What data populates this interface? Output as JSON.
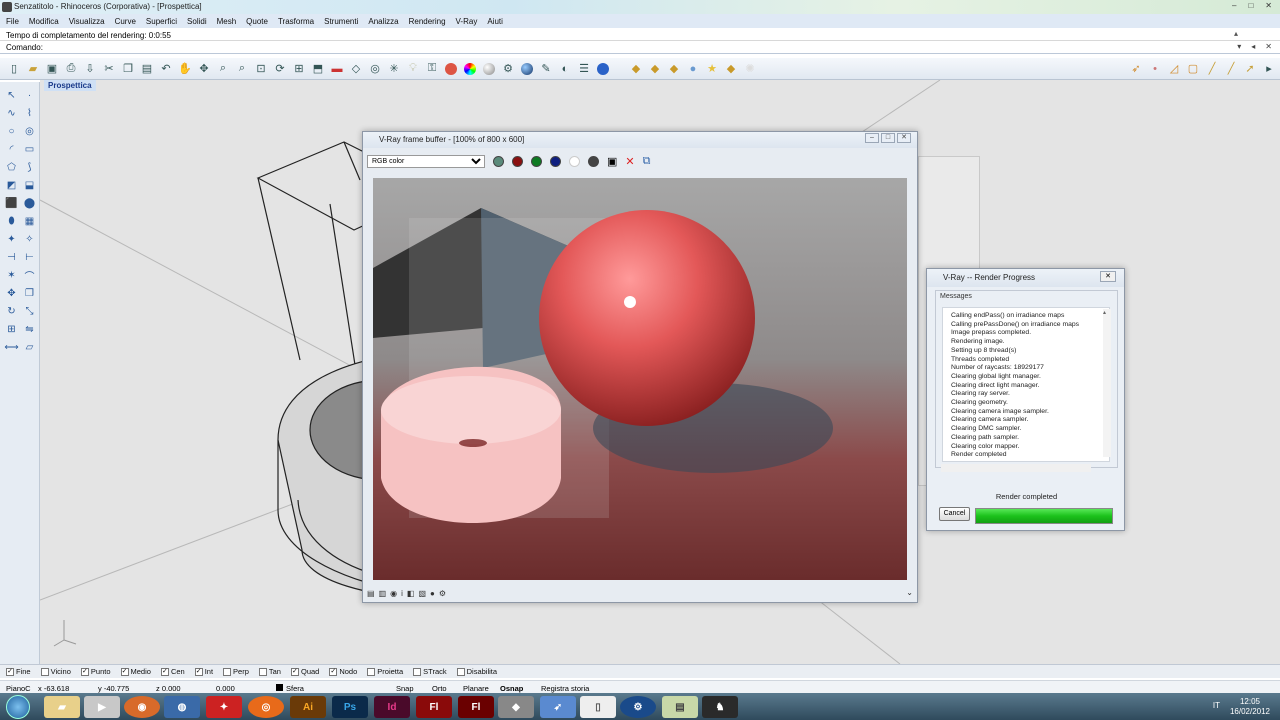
{
  "window": {
    "title": "Senzatitolo - Rhinoceros (Corporativa) - [Prospettica]"
  },
  "menu": [
    "File",
    "Modifica",
    "Visualizza",
    "Curve",
    "Superfici",
    "Solidi",
    "Mesh",
    "Quote",
    "Trasforma",
    "Strumenti",
    "Analizza",
    "Rendering",
    "V-Ray",
    "Aiuti"
  ],
  "command": {
    "history": "Tempo di completamento del rendering: 0:0:55",
    "prompt": "Comando:"
  },
  "viewport": {
    "label": "Prospettica"
  },
  "vfb": {
    "title": "V-Ray frame buffer - [100% of 800 x 600]",
    "channel": "RGB color",
    "channels": [
      "RGB color"
    ]
  },
  "progress": {
    "title": "V-Ray -- Render Progress",
    "group_label": "Messages",
    "messages": [
      "Calling endPass() on irradiance maps",
      "Calling prePassDone() on irradiance maps",
      "Image prepass completed.",
      "Rendering image.",
      "Setting up 8 thread(s)",
      "Threads completed",
      "Number of raycasts: 18929177",
      "Clearing global light manager.",
      "Clearing direct light manager.",
      "Clearing ray server.",
      "Clearing geometry.",
      "Clearing camera image sampler.",
      "Clearing camera sampler.",
      "Clearing DMC sampler.",
      "Clearing path sampler.",
      "Clearing color mapper.",
      "Render completed"
    ],
    "status": "Render completed",
    "cancel_label": "Cancel",
    "percent": 100,
    "color": "#1cc21c"
  },
  "osnap": [
    {
      "label": "Fine",
      "checked": true
    },
    {
      "label": "Vicino",
      "checked": false
    },
    {
      "label": "Punto",
      "checked": true
    },
    {
      "label": "Medio",
      "checked": true
    },
    {
      "label": "Cen",
      "checked": true
    },
    {
      "label": "Int",
      "checked": true
    },
    {
      "label": "Perp",
      "checked": false
    },
    {
      "label": "Tan",
      "checked": false
    },
    {
      "label": "Quad",
      "checked": true
    },
    {
      "label": "Nodo",
      "checked": true
    },
    {
      "label": "Proietta",
      "checked": false
    },
    {
      "label": "STrack",
      "checked": false
    },
    {
      "label": "Disabilita",
      "checked": false
    }
  ],
  "status": {
    "cplane": "PianoC",
    "x": "x -63.618",
    "y": "y -40.775",
    "z": "z 0.000",
    "extra": "0.000",
    "layer": "Sfera",
    "snap": "Snap",
    "orto": "Orto",
    "planare": "Planare",
    "osnap": "Osnap",
    "history": "Registra storia"
  },
  "taskbar": {
    "apps": [
      "Ai",
      "Ps",
      "Id",
      "Fl",
      "Fl"
    ],
    "lang": "IT",
    "time": "12:05",
    "date": "16/02/2012"
  }
}
